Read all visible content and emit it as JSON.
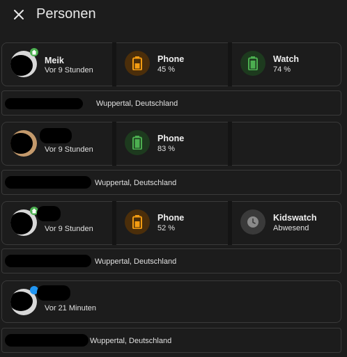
{
  "header": {
    "title": "Personen",
    "close_icon": "close-icon"
  },
  "persons": [
    {
      "name": "Meik",
      "last_seen": "Vor 9 Stunden",
      "badge": "home-icon",
      "devices": [
        {
          "name": "Phone",
          "value": "45 %",
          "icon": "battery-icon",
          "color": "#f39c12"
        },
        {
          "name": "Watch",
          "value": "74 %",
          "icon": "battery-icon",
          "color": "#4caf50"
        }
      ],
      "address": "Wuppertal, Deutschland"
    },
    {
      "name": "",
      "last_seen": "Vor 9 Stunden",
      "devices": [
        {
          "name": "Phone",
          "value": "83 %",
          "icon": "battery-icon",
          "color": "#4caf50"
        }
      ],
      "address": "Wuppertal, Deutschland"
    },
    {
      "name": "",
      "last_seen": "Vor 9 Stunden",
      "devices": [
        {
          "name": "Phone",
          "value": "52 %",
          "icon": "battery-icon",
          "color": "#f39c12"
        },
        {
          "name": "Kidswatch",
          "value": "Abwesend",
          "icon": "clock-icon",
          "color": "#8a8a8a"
        }
      ],
      "address": "Wuppertal, Deutschland"
    },
    {
      "name": "",
      "last_seen": "Vor 21 Minuten",
      "devices": [],
      "address": "Wuppertal, Deutschland"
    }
  ]
}
